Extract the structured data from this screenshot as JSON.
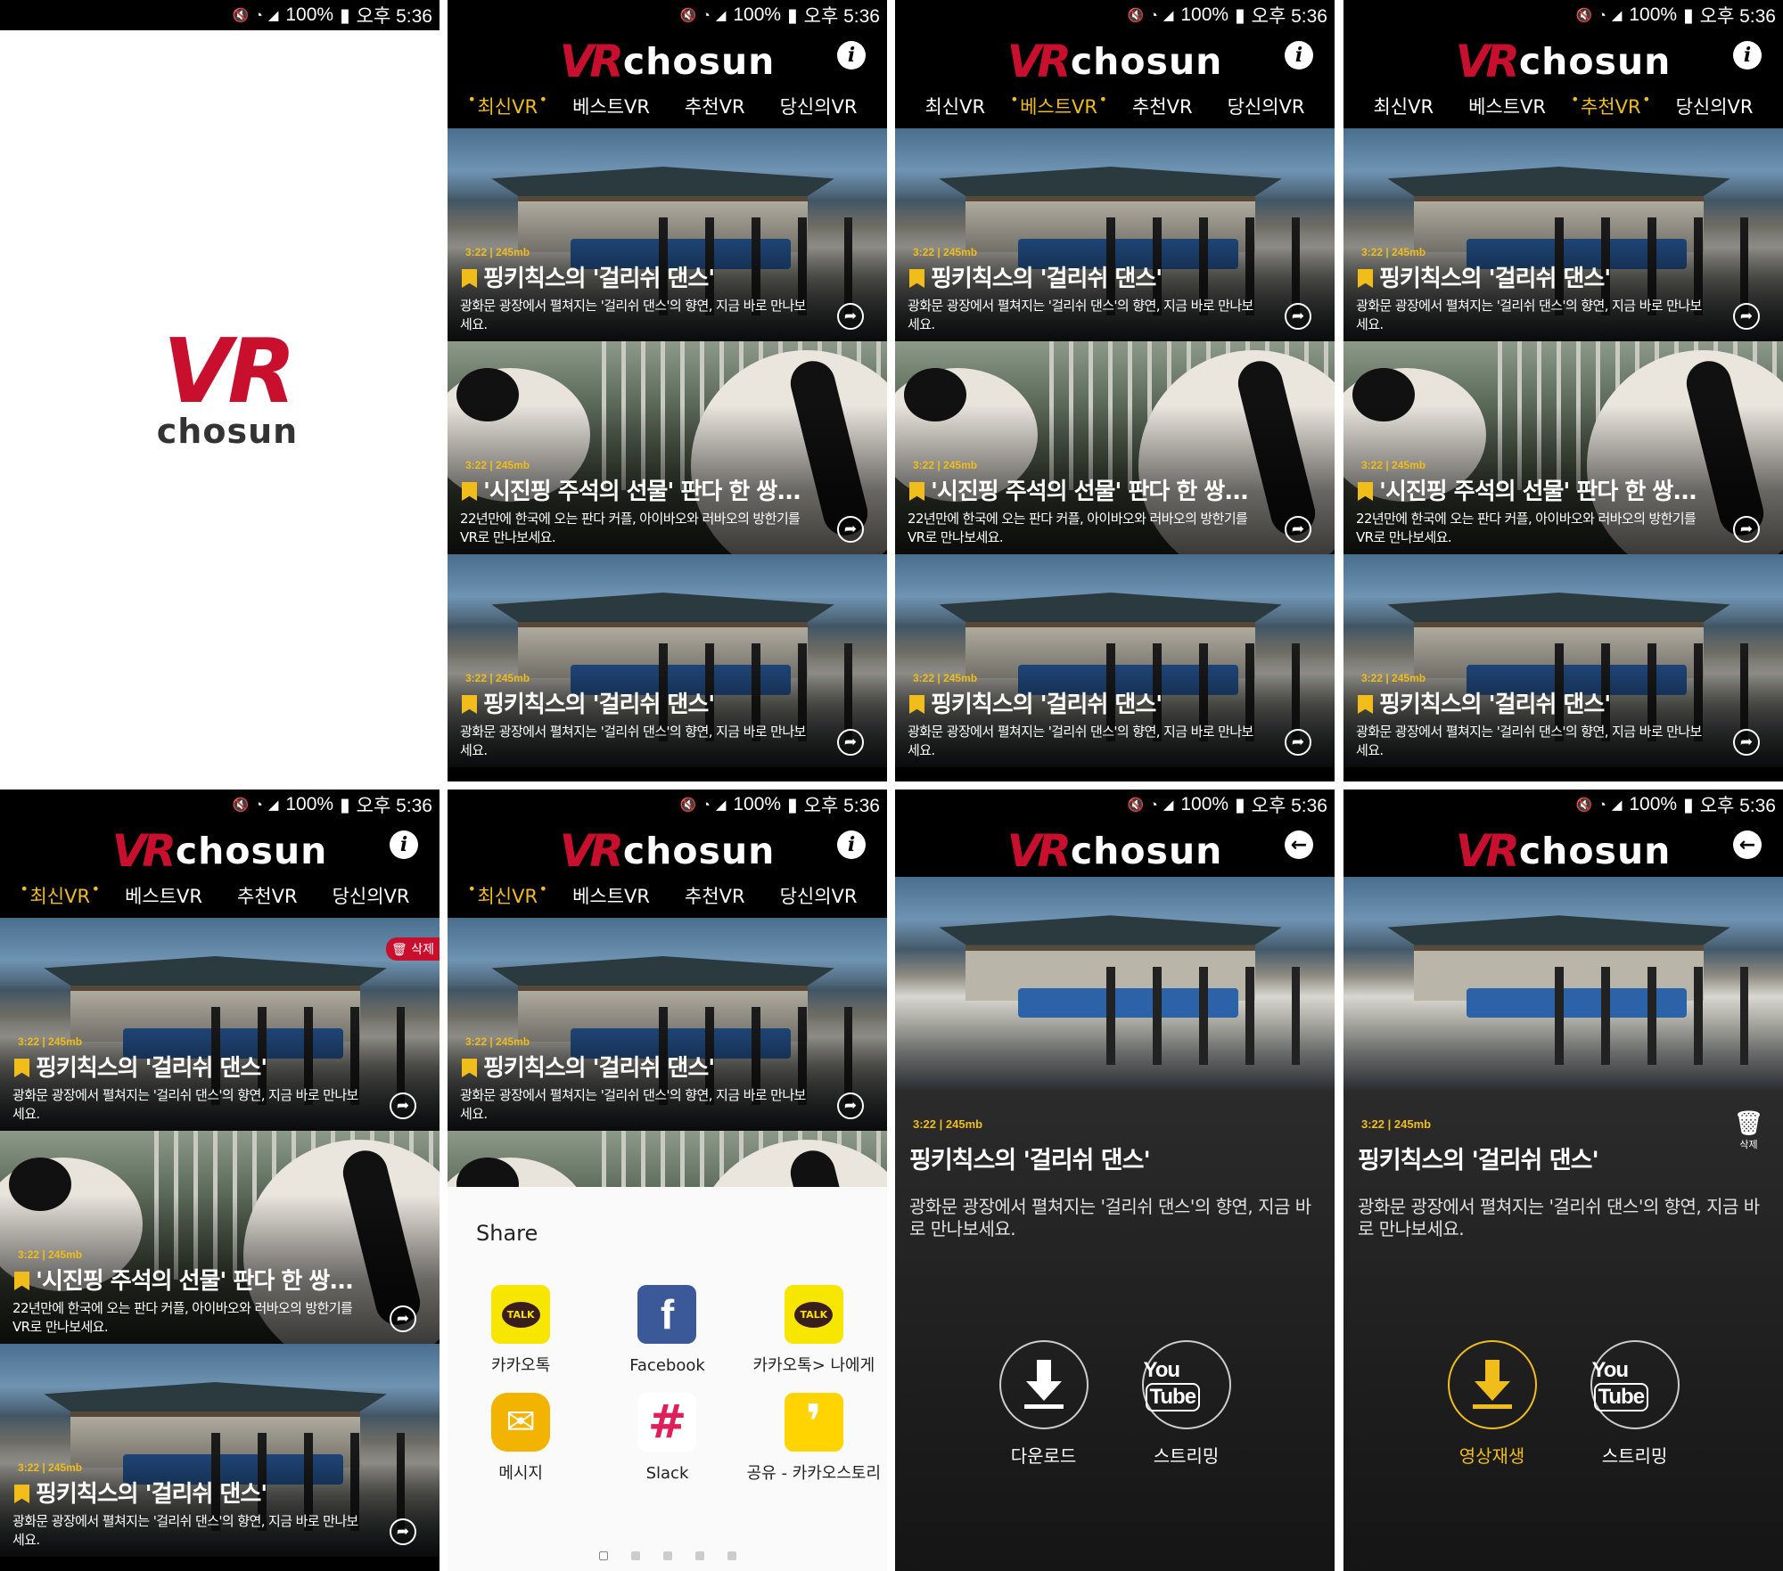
{
  "status": {
    "volume": "🔇",
    "wifi": "📶",
    "battery": "100%",
    "time": "오후 5:36"
  },
  "brand": {
    "mark": "VR",
    "word": "chosun"
  },
  "tabs": [
    "최신VR",
    "베스트VR",
    "추천VR",
    "당신의VR"
  ],
  "cards": [
    {
      "meta": "3:22 | 245mb",
      "title": "핑키칙스의 '걸리쉬 댄스'",
      "desc": "광화문 광장에서 펼쳐지는 '걸리쉬 댄스'의 향연, 지금 바로 만나보세요."
    },
    {
      "meta": "3:22 | 245mb",
      "title": "'시진핑 주석의 선물' 판다 한 쌍...",
      "desc": "22년만에 한국에 오는 판다 커플, 아이바오와 러바오의 방한기를 VR로 만나보세요."
    },
    {
      "meta": "3:22 | 245mb",
      "title": "핑키칙스의 '걸리쉬 댄스'",
      "desc": "광화문 광장에서 펼쳐지는 '걸리쉬 댄스'의 향연, 지금 바로 만나보세요."
    }
  ],
  "delete_badge": "삭제",
  "share": {
    "title": "Share",
    "items": [
      {
        "label": "카카오톡",
        "icon": "TALK",
        "color": "#f7e600"
      },
      {
        "label": "Facebook",
        "icon": "f",
        "color": "#3b5998"
      },
      {
        "label": "카카오톡> 나에게",
        "icon": "TALK",
        "color": "#f7e600"
      },
      {
        "label": "메시지",
        "icon": "✉",
        "color": "#f2b400"
      },
      {
        "label": "Slack",
        "icon": "#",
        "color": "#ffffff"
      },
      {
        "label": "공유 - 카카오스토리",
        "icon": "❜",
        "color": "#ffd400"
      }
    ]
  },
  "detail": {
    "meta": "3:22 | 245mb",
    "title": "핑키칙스의 '걸리쉬 댄스'",
    "desc": "광화문 광장에서 펼쳐지는 '걸리쉬 댄스'의 향연, 지금 바로 만나보세요.",
    "download": "다운로드",
    "streaming": "스트리밍",
    "play": "영상재생",
    "delete": "삭제",
    "youtube_a": "You",
    "youtube_b": "Tube"
  },
  "colors": {
    "accent": "#f0bd1a",
    "brand_red": "#c8102e"
  }
}
